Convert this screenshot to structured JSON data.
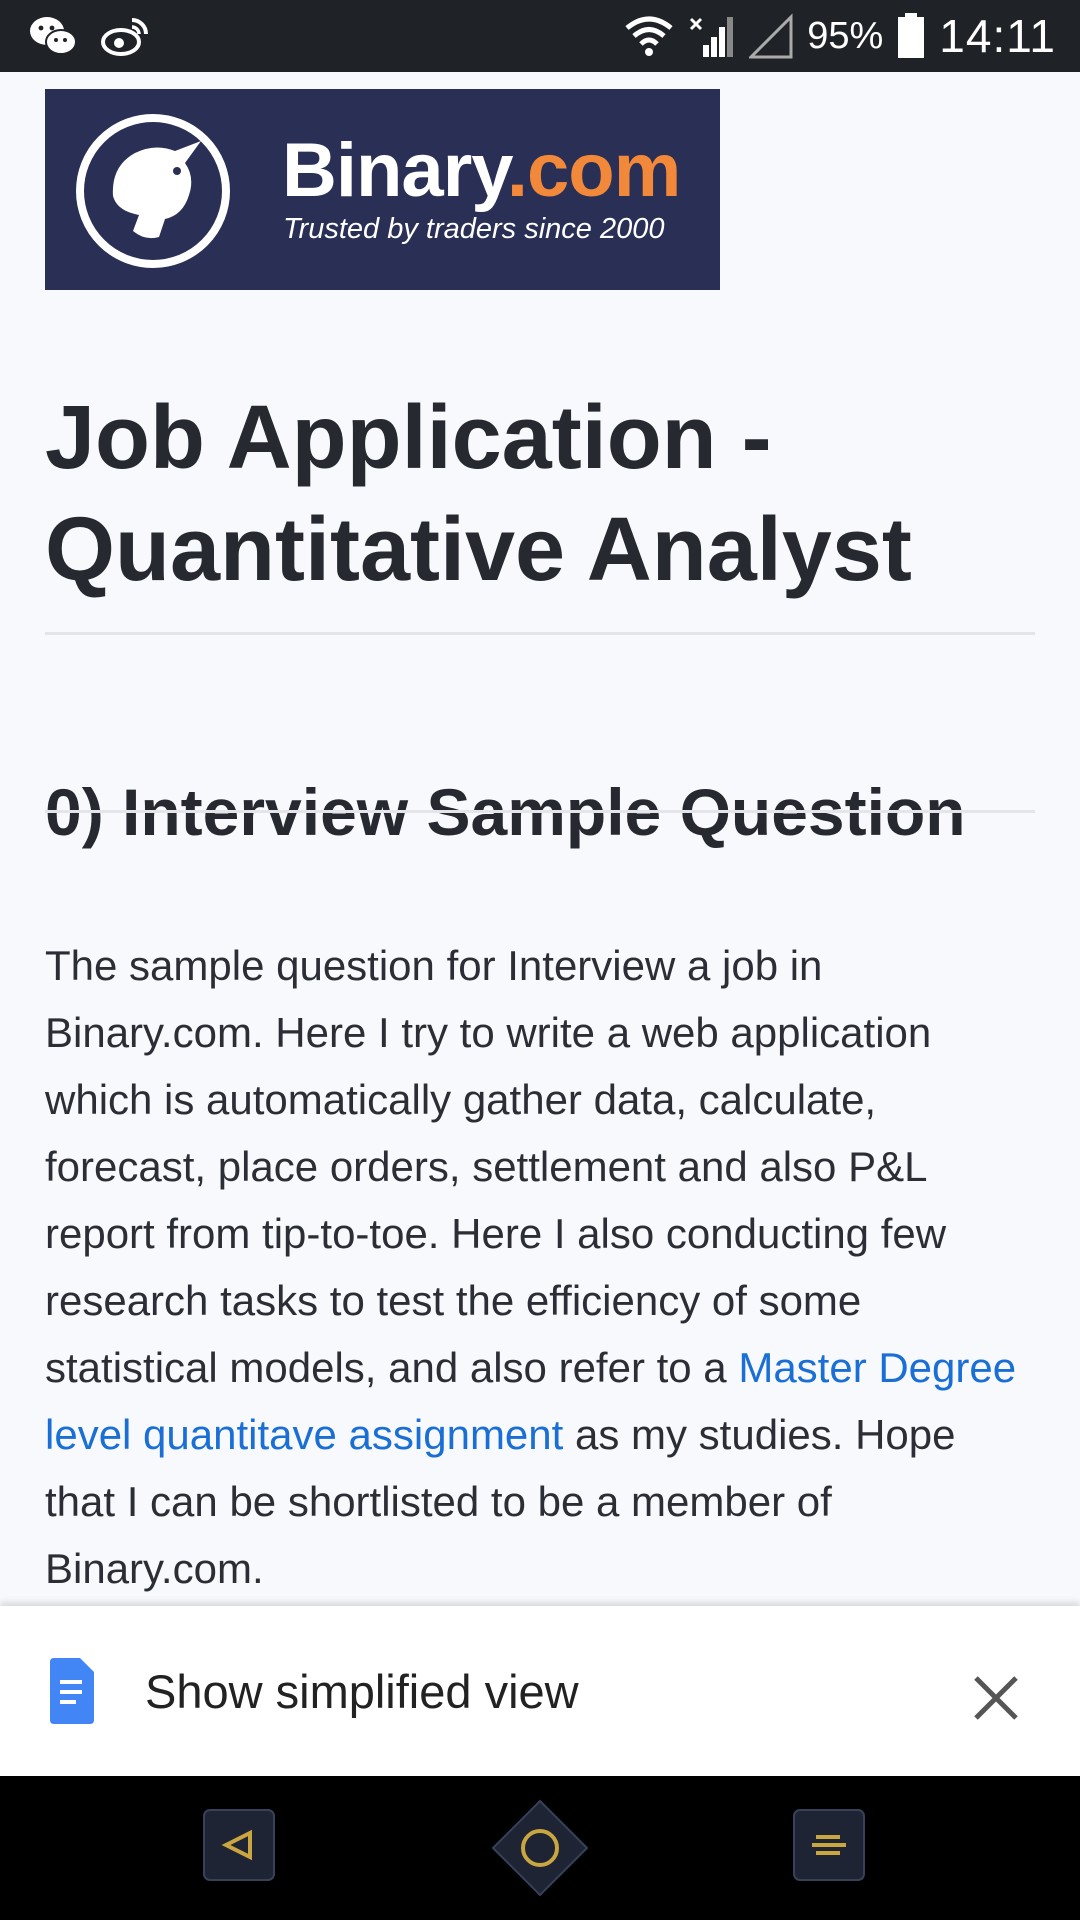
{
  "status_bar": {
    "left_icons": [
      "wechat-icon",
      "weibo-icon"
    ],
    "right_icons": [
      "wifi-icon",
      "signal-icon",
      "signal-empty-icon",
      "battery-icon"
    ],
    "battery": "95%",
    "time": "14:11"
  },
  "logo": {
    "brand_main": "Binary",
    "brand_accent": ".com",
    "tagline": "Trusted by traders since 2000",
    "colors": {
      "background": "#2a2f55",
      "accent": "#f2893a"
    }
  },
  "article": {
    "title": "Job Application - Quantitative Analyst",
    "section_title": "0) Interview Sample Question",
    "paragraph_before_link": "The sample question for Interview a job in Binary.com. Here I try to write a web application which is automatically gather data, calculate, forecast, place orders, settlement and also P&L report from tip-to-toe. Here I also conducting few research tasks to test the efficiency of some statistical models, and also refer to a ",
    "link_text": "Master Degree level quantitave assignment",
    "paragraph_after_link": " as my studies. Hope that I can be shortlisted to be a member of Binary.com.",
    "link_color": "#1a6fd6"
  },
  "simplified_view": {
    "label": "Show simplified view",
    "icon": "document-icon",
    "close_icon": "close-icon"
  },
  "nav_bar": {
    "buttons": [
      "back-icon",
      "home-icon",
      "recents-icon"
    ],
    "accent": "#c9a640"
  }
}
